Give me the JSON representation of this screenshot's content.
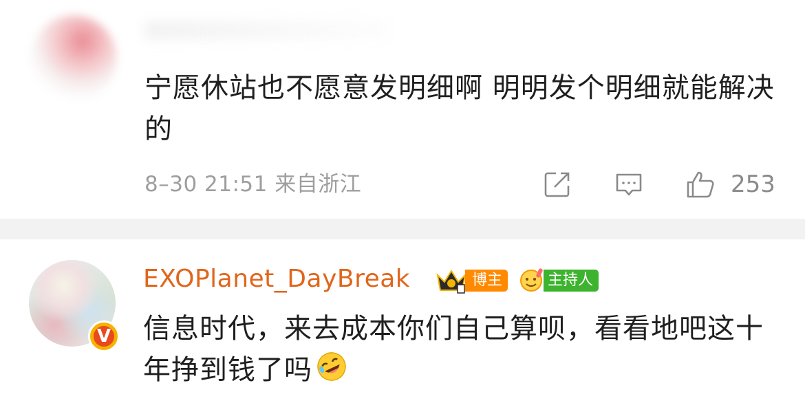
{
  "comments": [
    {
      "text": "宁愿休站也不愿意发明细啊 明明发个明细就能解决的",
      "meta": "8–30 21:51 来自浙江",
      "like_count": "253",
      "icons": [
        "share-icon",
        "reply-icon",
        "like-icon"
      ]
    },
    {
      "username": "EXOPlanet_DayBreak",
      "badge_blogger": "博主",
      "badge_host": "主持人",
      "verified_badge": "V",
      "text": "信息时代，来去成本你们自己算呗，看看地吧这十年挣到钱了吗",
      "emoji": "rolling-on-floor-laughing-icon"
    }
  ],
  "colors": {
    "username": "#e0661c",
    "blogger_tag": "#ff8a00",
    "host_tag": "#3db32f",
    "separator": "#f2f2f2",
    "meta_text": "#9e9e9e"
  }
}
